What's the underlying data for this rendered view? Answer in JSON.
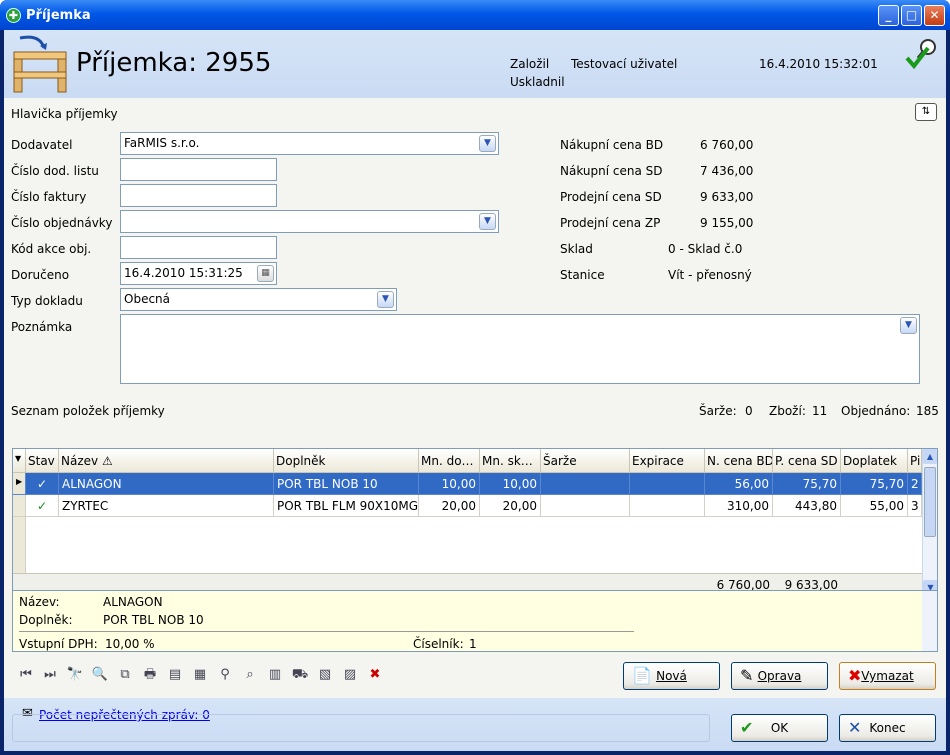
{
  "window": {
    "title": "Příjemka",
    "minimize": "_",
    "maximize": "□",
    "close": "✕"
  },
  "header": {
    "title": "Příjemka: 2955",
    "zalozil_label": "Založil",
    "zalozil_value": "Testovací uživatel",
    "uskladnil_label": "Uskladnil",
    "datetime": "16.4.2010 15:32:01"
  },
  "form": {
    "section_title": "Hlavička příjemky",
    "dodavatel_label": "Dodavatel",
    "dodavatel_value": "FaRMIS s.r.o.",
    "cislo_dod_listu_label": "Číslo dod. listu",
    "cislo_dod_listu_value": "",
    "cislo_faktury_label": "Číslo faktury",
    "cislo_faktury_value": "",
    "cislo_objednavky_label": "Číslo objednávky",
    "cislo_objednavky_value": "",
    "kod_akce_label": "Kód akce obj.",
    "kod_akce_value": "",
    "doruceno_label": "Doručeno",
    "doruceno_value": "16.4.2010 15:31:25",
    "typ_dokladu_label": "Typ dokladu",
    "typ_dokladu_value": "Obecná",
    "poznamka_label": "Poznámka",
    "poznamka_value": ""
  },
  "summary": {
    "nakupni_bd_label": "Nákupní cena BD",
    "nakupni_bd_value": "6 760,00",
    "nakupni_sd_label": "Nákupní cena SD",
    "nakupni_sd_value": "7 436,00",
    "prodejni_sd_label": "Prodejní cena SD",
    "prodejni_sd_value": "9 633,00",
    "prodejni_zp_label": "Prodejní cena ZP",
    "prodejni_zp_value": "9 155,00",
    "sklad_label": "Sklad",
    "sklad_value": "0 - Sklad č.0",
    "stanice_label": "Stanice",
    "stanice_value": "Vít - přenosný"
  },
  "list": {
    "title": "Seznam položek příjemky",
    "sarze_label": "Šarže:",
    "sarze_value": "0",
    "zbozi_label": "Zboží:",
    "zbozi_value": "11",
    "objednano_label": "Objednáno:",
    "objednano_value": "185",
    "columns": [
      "Stav",
      "Název",
      "Doplněk",
      "Mn. do…",
      "Mn. sk…",
      "Šarže",
      "Expirace",
      "N. cena BD",
      "P. cena SD",
      "Doplatek",
      "Pi"
    ],
    "rows": [
      {
        "nazev": "ALNAGON",
        "doplnek": "POR TBL NOB 10",
        "mn_do": "10,00",
        "mn_sk": "10,00",
        "sarze": "",
        "expirace": "",
        "n_cena": "56,00",
        "p_cena": "75,70",
        "doplatek": "75,70",
        "pi": "2"
      },
      {
        "nazev": "ZYRTEC",
        "doplnek": "POR TBL FLM 90X10MG",
        "mn_do": "20,00",
        "mn_sk": "20,00",
        "sarze": "",
        "expirace": "",
        "n_cena": "310,00",
        "p_cena": "443,80",
        "doplatek": "55,00",
        "pi": "3"
      }
    ],
    "total_n_cena": "6 760,00",
    "total_p_cena": "9 633,00"
  },
  "detail": {
    "nazev_label": "Název:",
    "nazev_value": "ALNAGON",
    "doplnek_label": "Doplněk:",
    "doplnek_value": "POR TBL NOB 10",
    "dph_label": "Vstupní DPH:",
    "dph_value": "10,00 %",
    "ciselnik_label": "Číselník:",
    "ciselnik_value": "1"
  },
  "buttons": {
    "nova": "Nová",
    "oprava": "Oprava",
    "vymazat": "Vymazat",
    "ok": "OK",
    "konec": "Konec"
  },
  "status": {
    "messages_link": "Počet nepřečtených zpráv: 0"
  }
}
